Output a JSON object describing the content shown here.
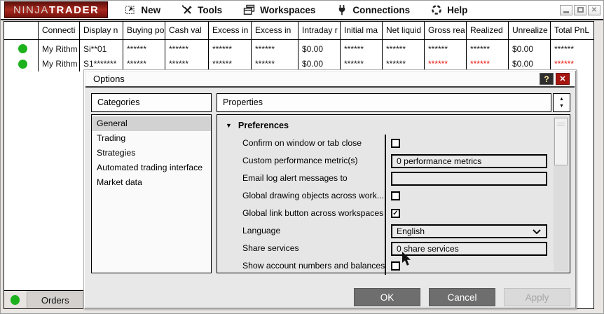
{
  "ui": {
    "icons": {
      "scroll_up": "▲",
      "scroll_down": "▼",
      "group_collapse": "▼",
      "check": "✓",
      "close": "✕",
      "help": "?"
    }
  },
  "menubar": {
    "logo_part1": "NINJA",
    "logo_part2": "TRADER",
    "items": [
      {
        "label": "New"
      },
      {
        "label": "Tools"
      },
      {
        "label": "Workspaces"
      },
      {
        "label": "Connections"
      },
      {
        "label": "Help"
      }
    ]
  },
  "accounts_table": {
    "columns": [
      "",
      "Connecti",
      "Display n",
      "Buying po",
      "Cash val",
      "Excess in",
      "Excess in",
      "Intraday r",
      "Initial ma",
      "Net liquid",
      "Gross rea",
      "Realized",
      "Unrealize",
      "Total PnL"
    ],
    "rows": [
      {
        "status": "connected",
        "cells": [
          "",
          "My Rithm",
          "Si**01",
          "******",
          "******",
          "******",
          "******",
          "$0.00",
          "******",
          "******",
          "******",
          "******",
          "$0.00",
          "******"
        ]
      },
      {
        "status": "connected",
        "cells": [
          "",
          "My Rithm",
          "S1*******",
          "******",
          "******",
          "******",
          "******",
          "$0.00",
          "******",
          "******",
          "******",
          "******",
          "$0.00",
          "******"
        ]
      }
    ],
    "negative_color": "#e8100a",
    "status_green": "#1db21d"
  },
  "status_bar": {
    "orders_tab": "Orders"
  },
  "options_dialog": {
    "title": "Options",
    "categories": {
      "header": "Categories",
      "items": [
        {
          "label": "General",
          "selected": true
        },
        {
          "label": "Trading",
          "selected": false
        },
        {
          "label": "Strategies",
          "selected": false
        },
        {
          "label": "Automated trading interface",
          "selected": false
        },
        {
          "label": "Market data",
          "selected": false
        }
      ]
    },
    "properties": {
      "header": "Properties",
      "group": "Preferences",
      "rows": [
        {
          "label": "Confirm on window or tab close",
          "type": "checkbox",
          "checked": false
        },
        {
          "label": "Custom performance metric(s)",
          "type": "text",
          "value": "0 performance metrics"
        },
        {
          "label": "Email log alert messages to",
          "type": "text",
          "value": ""
        },
        {
          "label": "Global drawing objects across work...",
          "type": "checkbox",
          "checked": false
        },
        {
          "label": "Global link button across workspaces",
          "type": "checkbox",
          "checked": true
        },
        {
          "label": "Language",
          "type": "select",
          "value": "English"
        },
        {
          "label": "Share services",
          "type": "text",
          "value": "0 share services"
        },
        {
          "label": "Show account numbers and balances",
          "type": "checkbox",
          "checked": false
        }
      ]
    },
    "buttons": {
      "ok": "OK",
      "cancel": "Cancel",
      "apply": "Apply"
    }
  }
}
